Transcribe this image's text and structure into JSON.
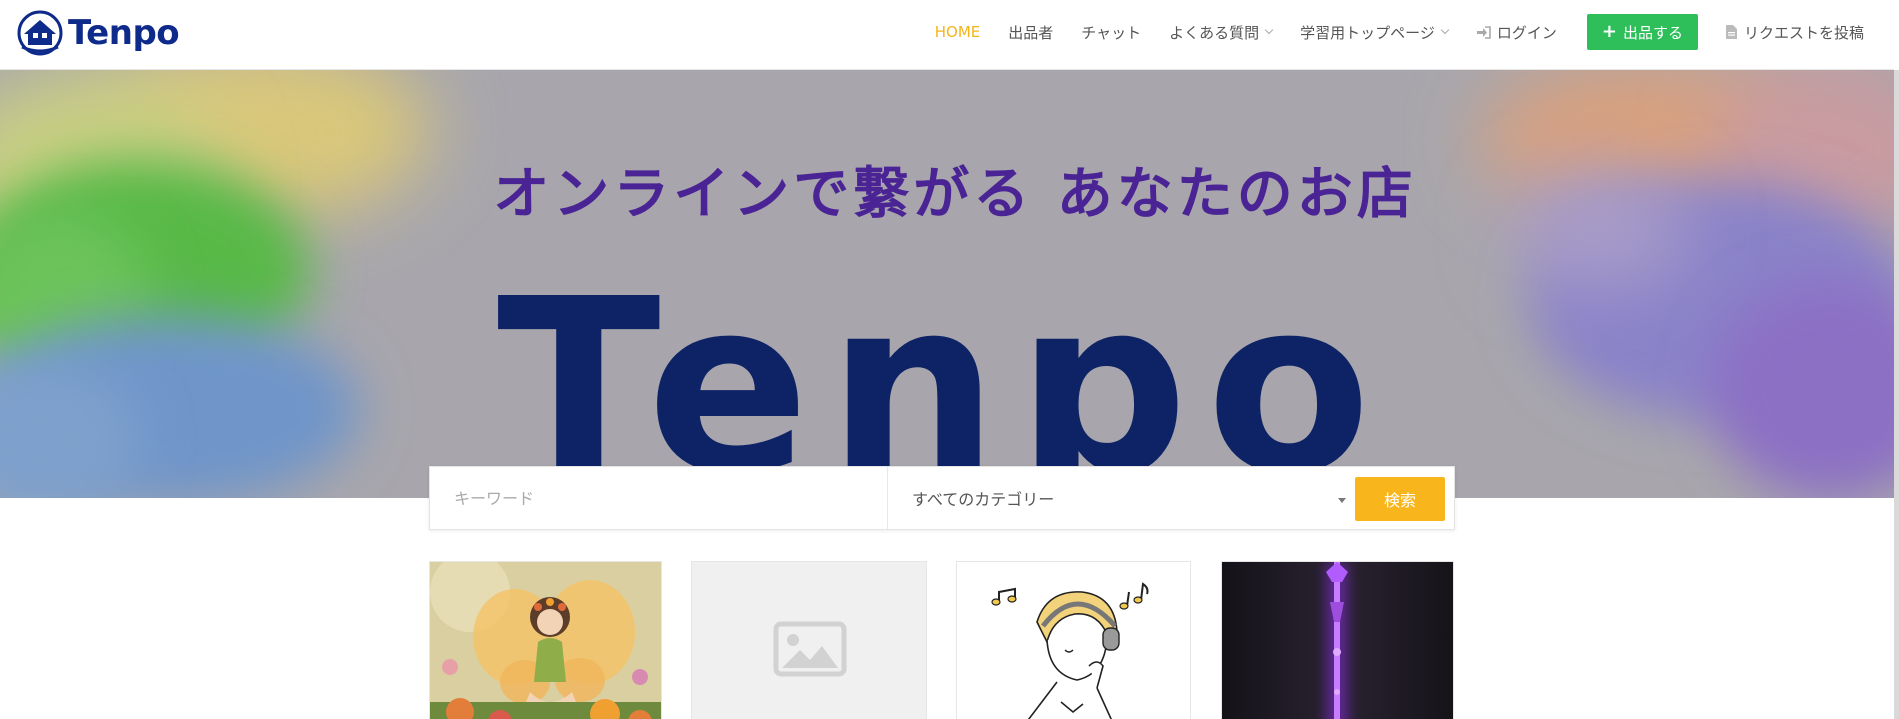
{
  "brand": {
    "name": "Tenpo"
  },
  "nav": {
    "items": [
      {
        "label": "HOME",
        "active": true
      },
      {
        "label": "出品者"
      },
      {
        "label": "チャット"
      },
      {
        "label": "よくある質問",
        "dropdown": true
      },
      {
        "label": "学習用トップページ",
        "dropdown": true
      }
    ],
    "login": "ログイン",
    "post": "出品する",
    "request": "リクエストを投稿"
  },
  "hero": {
    "tagline": "オンラインで繋がる あなたのお店",
    "title": "Tenpo"
  },
  "search": {
    "keyword_placeholder": "キーワード",
    "category": "すべてのカテゴリー",
    "button": "検索"
  },
  "cards": [
    {
      "image": "fairy-illustration"
    },
    {
      "image": "image-placeholder-icon"
    },
    {
      "image": "girl-headphones-music-illustration"
    },
    {
      "image": "purple-sword-dark"
    }
  ],
  "colors": {
    "accent": "#f9b61c",
    "active_nav": "#f5b41a",
    "post_button": "#2ebf5a",
    "brand": "#0e2a8a",
    "tagline": "#4a2494"
  }
}
